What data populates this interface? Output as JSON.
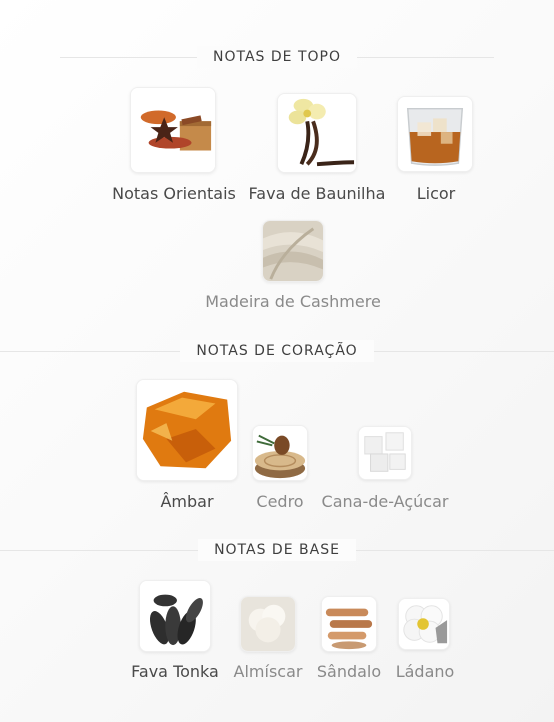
{
  "sections": {
    "top": {
      "title": "NOTAS DE TOPO",
      "notes": [
        {
          "label": "Notas Orientais",
          "icon": "spices-icon"
        },
        {
          "label": "Fava de Baunilha",
          "icon": "vanilla-bean-icon"
        },
        {
          "label": "Licor",
          "icon": "liquor-glass-icon"
        },
        {
          "label": "Madeira de Cashmere",
          "icon": "cashmere-fabric-icon"
        }
      ]
    },
    "heart": {
      "title": "NOTAS DE CORAÇÃO",
      "notes": [
        {
          "label": "Âmbar",
          "icon": "amber-resin-icon"
        },
        {
          "label": "Cedro",
          "icon": "cedar-wood-icon"
        },
        {
          "label": "Cana-de-Açúcar",
          "icon": "sugar-cubes-icon"
        }
      ]
    },
    "base": {
      "title": "NOTAS DE BASE",
      "notes": [
        {
          "label": "Fava Tonka",
          "icon": "tonka-beans-icon"
        },
        {
          "label": "Almíscar",
          "icon": "musk-cotton-icon"
        },
        {
          "label": "Sândalo",
          "icon": "sandalwood-sticks-icon"
        },
        {
          "label": "Ládano",
          "icon": "cistus-flower-icon"
        }
      ]
    }
  },
  "colors": {
    "background": "#fafafa",
    "strong_text": "#4a4a4a",
    "soft_text": "#8a8a8a",
    "divider": "#e6e6e6"
  }
}
